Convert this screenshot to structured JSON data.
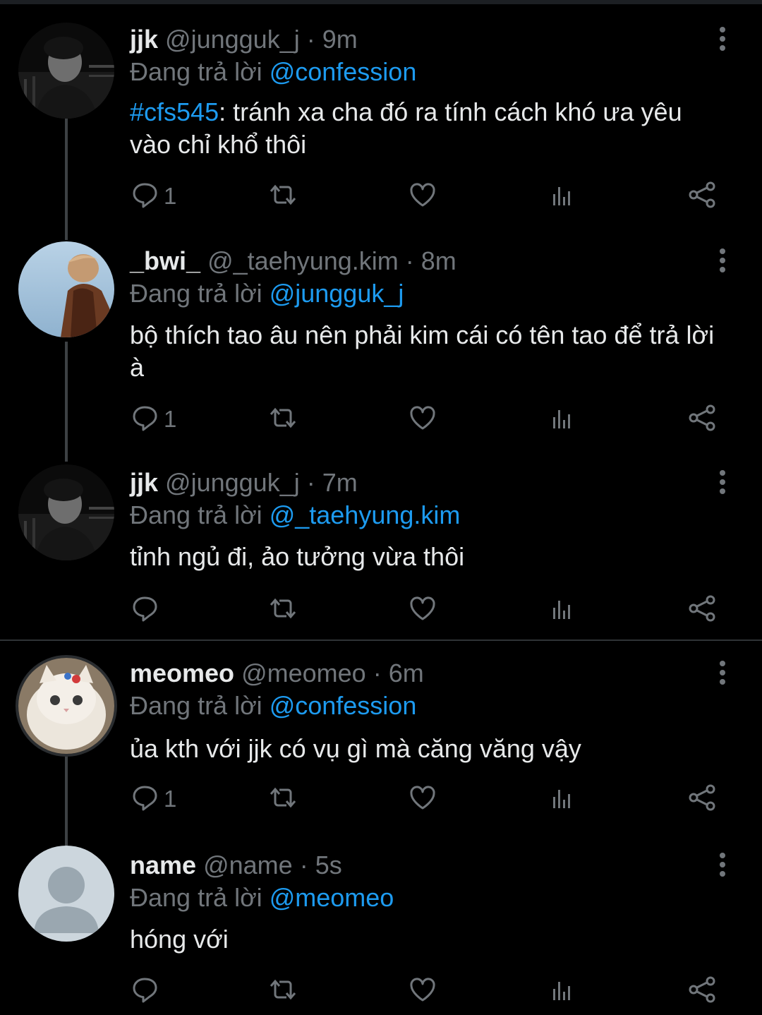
{
  "colors": {
    "background": "#000000",
    "accent": "#1d9bf0",
    "muted": "#71767b",
    "text": "#e7e9ea"
  },
  "tweets": [
    {
      "name": "jjk",
      "handle": "@jungguk_j",
      "dot": "·",
      "time": "9m",
      "reply_prefix": "Đang trả lời ",
      "reply_to": "@confession",
      "hashtag": "#cfs545",
      "text": ": tránh xa cha đó ra tính cách khó ưa yêu vào chỉ khổ thôi",
      "reply_count": "1",
      "avatar": "dark-portrait"
    },
    {
      "name": "_bwi_",
      "handle": "@_taehyung.kim",
      "dot": "·",
      "time": "8m",
      "reply_prefix": "Đang trả lời ",
      "reply_to": "@jungguk_j",
      "hashtag": "",
      "text": "bộ thích tao âu nên phải kim cái có tên tao để trả lời à",
      "reply_count": "1",
      "avatar": "sky-portrait"
    },
    {
      "name": "jjk",
      "handle": "@jungguk_j",
      "dot": "·",
      "time": "7m",
      "reply_prefix": "Đang trả lời ",
      "reply_to": "@_taehyung.kim",
      "hashtag": "",
      "text": "tỉnh ngủ đi, ảo tưởng vừa thôi",
      "reply_count": "",
      "avatar": "dark-portrait"
    },
    {
      "name": "meomeo",
      "handle": "@meomeo",
      "dot": "·",
      "time": "6m",
      "reply_prefix": "Đang trả lời ",
      "reply_to": "@confession",
      "hashtag": "",
      "text": "ủa kth với jjk có vụ gì mà căng văng vậy",
      "reply_count": "1",
      "avatar": "cat"
    },
    {
      "name": "name",
      "handle": "@name",
      "dot": "·",
      "time": "5s",
      "reply_prefix": "Đang trả lời ",
      "reply_to": "@meomeo",
      "hashtag": "",
      "text": "hóng với",
      "reply_count": "",
      "avatar": "default-user"
    }
  ]
}
